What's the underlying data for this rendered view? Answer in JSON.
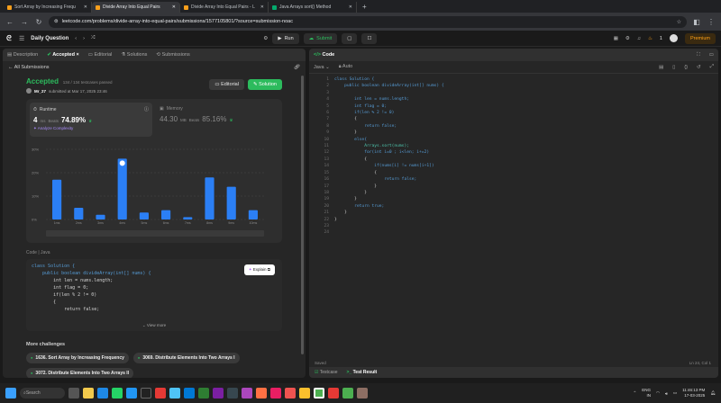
{
  "browser": {
    "tabs": [
      {
        "title": "Sort Array by Increasing Frequ",
        "active": false,
        "fav": "lc"
      },
      {
        "title": "Divide Array Into Equal Pairs",
        "active": true,
        "fav": "lc"
      },
      {
        "title": "Divide Array Into Equal Pairs - L",
        "active": false,
        "fav": "lc"
      },
      {
        "title": "Java Arrays sort() Method",
        "active": false,
        "fav": "w3"
      }
    ],
    "url": "leetcode.com/problems/divide-array-into-equal-pairs/submissions/1577105801/?source=submission-noac"
  },
  "nav": {
    "title": "Daily Question",
    "run": "Run",
    "submit": "Submit",
    "premium": "Premium",
    "fire_count": "1"
  },
  "left": {
    "tabs": [
      "Description",
      "Accepted",
      "Editorial",
      "Solutions",
      "Submissions"
    ],
    "back_label": "All Submissions",
    "status": "Accepted",
    "passed": "134 / 134 testcases passed",
    "user": "Mr_27",
    "submitted_at": "submitted at Mar 17, 2025 23:46",
    "editorial_btn": "Editorial",
    "solution_btn": "Solution",
    "runtime_label": "Runtime",
    "runtime_value": "4",
    "runtime_unit": "ms",
    "beats_label": "Beats",
    "runtime_beats": "74.89%",
    "analyze": "Analyze Complexity",
    "memory_label": "Memory",
    "memory_value": "44.30",
    "memory_unit": "MB",
    "memory_beats_label": "Beats",
    "memory_beats": "85.16%",
    "code_label": "Code",
    "code_lang": "Java",
    "explain_btn": "Explain",
    "code_lines": [
      "class Solution {",
      "    public boolean divideArray(int[] nums) {",
      "",
      "        int len = nums.length;",
      "        int flag = 0;",
      "        if(len % 2 != 0)",
      "        {",
      "            return false;"
    ],
    "view_more": "View more",
    "more_title": "More challenges",
    "challenges": [
      "1636. Sort Array by Increasing Frequency",
      "3069. Distribute Elements Into Two Arrays I",
      "3072. Distribute Elements Into Two Arrays II"
    ]
  },
  "chart_data": {
    "type": "bar",
    "categories": [
      "1ms",
      "2ms",
      "3ms",
      "4ms",
      "5ms",
      "6ms",
      "7ms",
      "8ms",
      "9ms",
      "10ms"
    ],
    "values": [
      17,
      5,
      2,
      26,
      3,
      4,
      1,
      18,
      14,
      4
    ],
    "highlight_index": 3,
    "y_ticks": [
      "30%",
      "20%",
      "10%",
      "0%"
    ],
    "ylim": [
      0,
      30
    ],
    "bar_color": "#2b7ff5",
    "grid": true
  },
  "right": {
    "title": "Code",
    "lang": "Java",
    "auto": "Auto",
    "saved": "Saved",
    "cursor": "Ln 24, Col 1",
    "testcase": "Testcase",
    "test_result": "Test Result",
    "lines": [
      "class Solution {",
      "    public boolean divideArray(int[] nums) {",
      "",
      "        int len = nums.length;",
      "        int flag = 0;",
      "        if(len % 2 != 0)",
      "        {",
      "            return false;",
      "        }",
      "        else{",
      "            Arrays.sort(nums);",
      "            for(int i=0 ; i<len; i+=2)",
      "            {",
      "                if(nums[i] != nums[i+1])",
      "                {",
      "                    return false;",
      "                }",
      "            }",
      "        }",
      "        return true;",
      "    }",
      "}",
      "",
      ""
    ]
  },
  "taskbar": {
    "search": "Search",
    "lang": "ENG",
    "region": "IN",
    "time": "11:46:13 PM",
    "date": "17-03-2025"
  }
}
